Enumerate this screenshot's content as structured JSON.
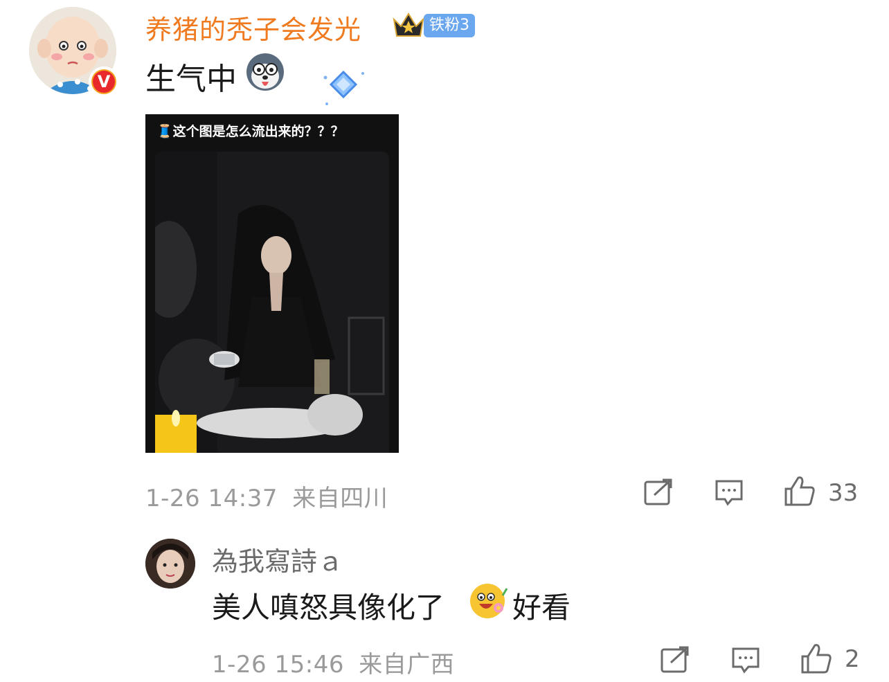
{
  "post": {
    "username": "养猪的秃子会发光",
    "fan_badge": "铁粉3",
    "verified_badge": "V",
    "text": "生气中",
    "image_caption": "🧵这个图是怎么流出来的？？？",
    "timestamp": "1-26 14:37",
    "location": "来自四川",
    "like_count": "33"
  },
  "reply": {
    "username": "為我寫詩ａ",
    "text_part1": "美人嗔怒具像化了",
    "text_part2": "好看",
    "timestamp": "1-26 15:46",
    "location": "来自广西",
    "like_count": "2"
  },
  "colors": {
    "username_orange": "#f07a1f",
    "fan_badge_blue": "#6aa7ee",
    "meta_gray": "#9a9a9a"
  },
  "icons": [
    "share-icon",
    "comment-icon",
    "like-icon",
    "crown-icon",
    "husky-emoji-icon",
    "diamond-icon",
    "happy-flower-emoji-icon"
  ]
}
